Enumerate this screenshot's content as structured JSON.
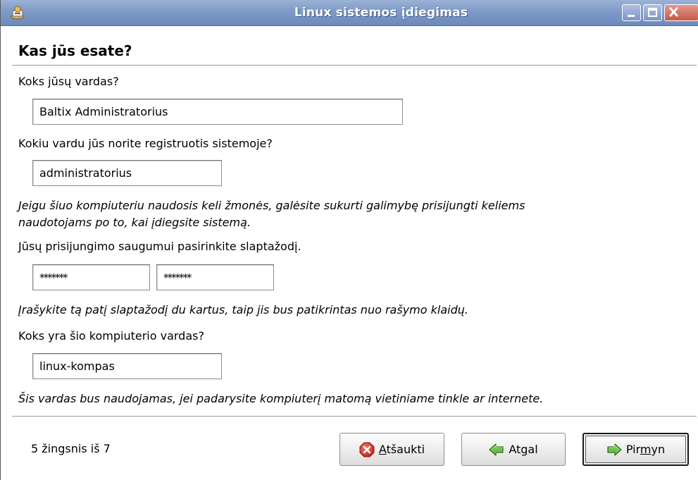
{
  "window": {
    "title": "Linux sistemos įdiegimas",
    "controls": [
      "minimize",
      "maximize",
      "close"
    ]
  },
  "page": {
    "heading": "Kas jūs esate?"
  },
  "full_name": {
    "label": "Koks jūsų vardas?",
    "value": "Baltix Administratorius"
  },
  "username": {
    "label": "Kokiu vardu jūs norite registruotis sistemoje?",
    "value": "administratorius",
    "hint_line1": "Jeigu šiuo kompiuteriu naudosis keli žmonės, galėsite sukurti galimybę prisijungti keliems",
    "hint_line2": "naudotojams po to, kai įdiegsite sistemą."
  },
  "password": {
    "label": "Jūsų prisijungimo saugumui pasirinkite slaptažodį.",
    "value": "*******",
    "confirm_value": "*******",
    "hint": "Įrašykite tą patį slaptažodį du kartus, taip jis bus patikrintas nuo rašymo klaidų."
  },
  "hostname": {
    "label": "Koks yra šio kompiuterio vardas?",
    "value": "linux-kompas",
    "hint": "Šis vardas bus naudojamas, jei padarysite kompiuterį matomą vietiniame tinkle ar internete."
  },
  "footer": {
    "step_text": "5 žingsnis iš 7",
    "cancel_mnemonic": "A",
    "cancel_rest": "tšaukti",
    "back_pre": "At",
    "back_mnemonic": "g",
    "back_post": "al",
    "forward_pre": "Pir",
    "forward_mnemonic": "m",
    "forward_post": "yn"
  },
  "icons": {
    "app": "installer-icon",
    "cancel": "cancel-icon",
    "back": "arrow-left-icon",
    "forward": "arrow-right-icon"
  },
  "colors": {
    "titlebar": "#7e99c6",
    "cancel_icon": "#d62b22",
    "arrow_icon": "#5fb33b"
  }
}
